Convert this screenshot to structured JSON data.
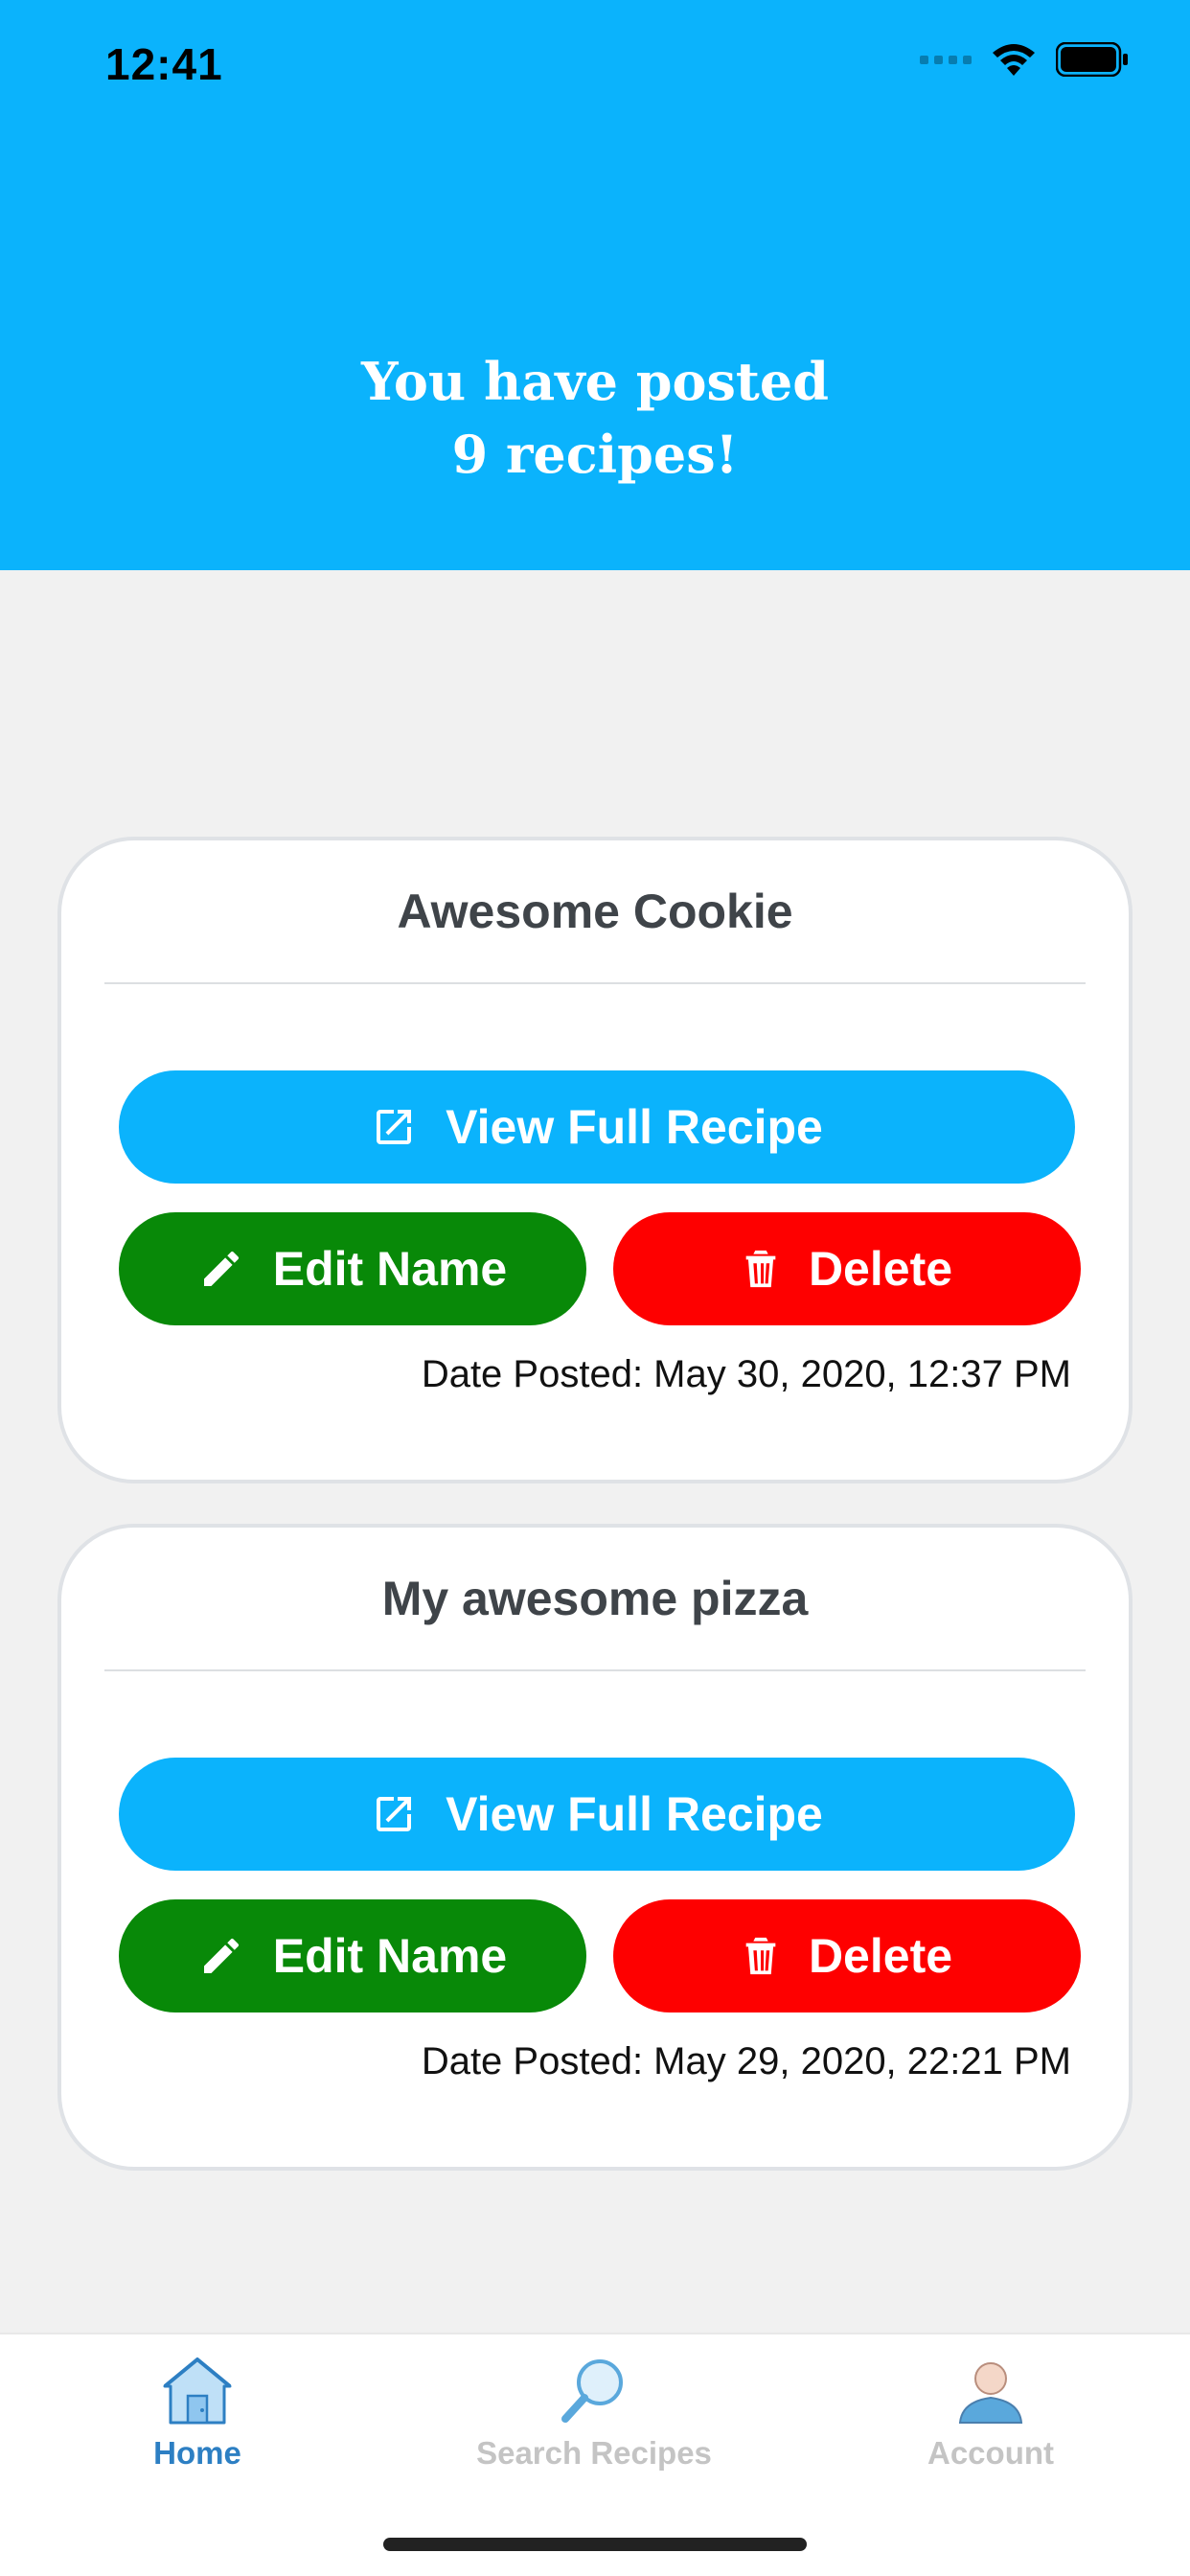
{
  "status_bar": {
    "time": "12:41"
  },
  "header": {
    "line1": "You have posted",
    "line2": "9 recipes!"
  },
  "recipes": [
    {
      "name": "Awesome Cookie",
      "view_label": "View Full Recipe",
      "edit_label": "Edit Name",
      "delete_label": "Delete",
      "date": "Date Posted: May 30, 2020, 12:37 PM"
    },
    {
      "name": "My awesome pizza",
      "view_label": "View Full Recipe",
      "edit_label": "Edit Name",
      "delete_label": "Delete",
      "date": "Date Posted: May 29, 2020, 22:21 PM"
    }
  ],
  "tabs": {
    "home": "Home",
    "search": "Search Recipes",
    "account": "Account"
  },
  "colors": {
    "header_bg": "#0bb3fc",
    "view_btn": "#0bb3fc",
    "edit_btn": "#088908",
    "delete_btn": "#fe0000",
    "active_tab": "#2d7fc3"
  }
}
